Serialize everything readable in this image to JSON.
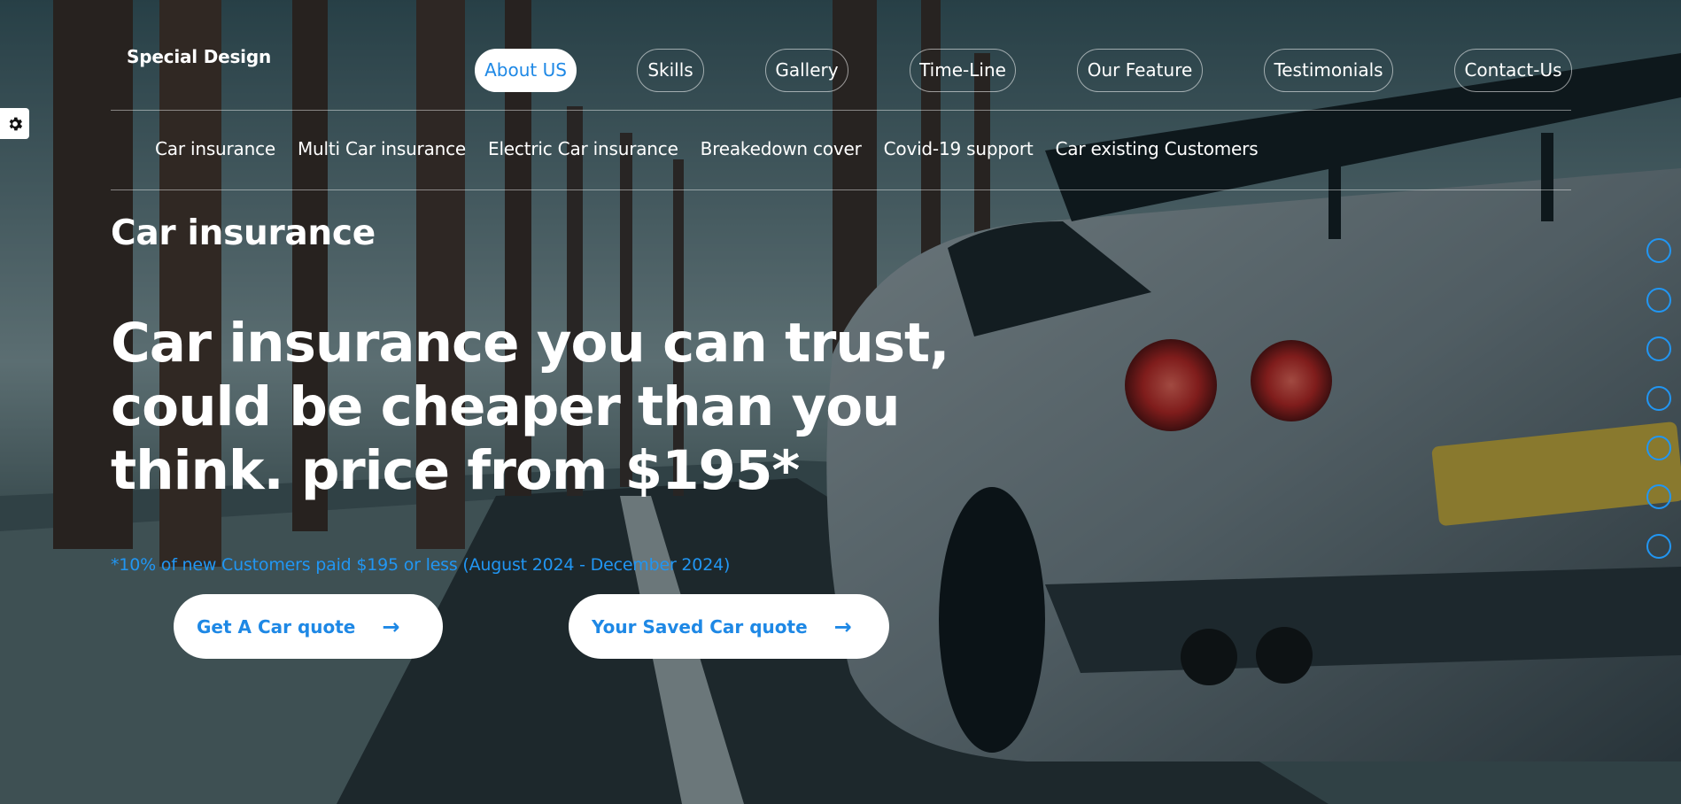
{
  "brand": {
    "name": "Special Design"
  },
  "main_nav": [
    {
      "label": "About US",
      "active": true
    },
    {
      "label": "Skills",
      "active": false
    },
    {
      "label": "Gallery",
      "active": false
    },
    {
      "label": "Time-Line",
      "active": false
    },
    {
      "label": "Our Feature",
      "active": false
    },
    {
      "label": "Testimonials",
      "active": false
    },
    {
      "label": "Contact-Us",
      "active": false
    }
  ],
  "sub_nav": [
    "Car insurance",
    "Multi Car insurance",
    "Electric Car insurance",
    "Breakedown cover",
    "Covid-19 support",
    "Car existing Customers"
  ],
  "hero": {
    "section_title": "Car insurance",
    "headline": "Car insurance you can trust, could be cheaper than you think. price from $195*",
    "disclaimer": "*10% of new Customers paid $195 or less (August 2024 - December 2024)",
    "buttons": [
      {
        "label": "Get A Car quote",
        "icon": "arrow-right-icon"
      },
      {
        "label": "Your Saved Car quote",
        "icon": "arrow-right-icon"
      }
    ]
  },
  "settings": {
    "icon": "gear-icon"
  },
  "nav_bullets": {
    "count": 7
  },
  "colors": {
    "accent": "#1e88e5",
    "bullet": "#2196f3"
  }
}
